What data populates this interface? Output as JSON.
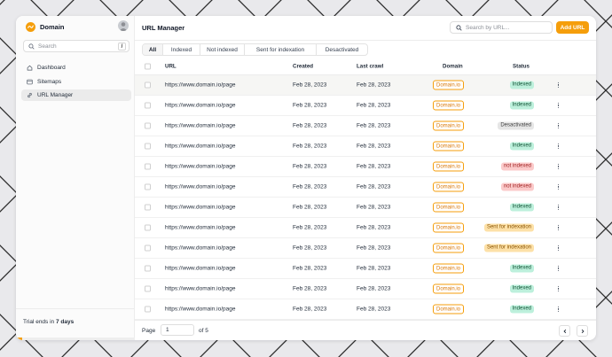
{
  "brand": {
    "name": "Domain",
    "color": "#f59e0b"
  },
  "sidebar": {
    "search_placeholder": "Search",
    "search_shortcut": "/",
    "items": [
      {
        "label": "Dashboard",
        "icon": "home-icon"
      },
      {
        "label": "Sitemaps",
        "icon": "sitemap-icon"
      },
      {
        "label": "URL Manager",
        "icon": "link-icon",
        "active": true
      }
    ],
    "trial": {
      "prefix": "Trial ends in ",
      "days": "7 days",
      "progress": 0.05
    }
  },
  "header": {
    "title": "URL Manager",
    "search_placeholder": "Search by URL...",
    "add_label": "Add URL"
  },
  "tabs": [
    "All",
    "Indexed",
    "Not indexed",
    "Sent for indexation",
    "Desactivated"
  ],
  "table": {
    "columns": {
      "url": "URL",
      "created": "Created",
      "crawl": "Last crawl",
      "domain": "Domain",
      "status": "Status"
    },
    "rows": [
      {
        "url": "https://www.domain.io/page",
        "created": "Feb 28, 2023",
        "crawl": "Feb 28, 2023",
        "domain": "Domain.io",
        "status": "Indexed",
        "kind": "indexed"
      },
      {
        "url": "https://www.domain.io/page",
        "created": "Feb 28, 2023",
        "crawl": "Feb 28, 2023",
        "domain": "Domain.io",
        "status": "Indexed",
        "kind": "indexed"
      },
      {
        "url": "https://www.domain.io/page",
        "created": "Feb 28, 2023",
        "crawl": "Feb 28, 2023",
        "domain": "Domain.io",
        "status": "Desactivated",
        "kind": "deactivated"
      },
      {
        "url": "https://www.domain.io/page",
        "created": "Feb 28, 2023",
        "crawl": "Feb 28, 2023",
        "domain": "Domain.io",
        "status": "Indexed",
        "kind": "indexed"
      },
      {
        "url": "https://www.domain.io/page",
        "created": "Feb 28, 2023",
        "crawl": "Feb 28, 2023",
        "domain": "Domain.io",
        "status": "not indexed",
        "kind": "not"
      },
      {
        "url": "https://www.domain.io/page",
        "created": "Feb 28, 2023",
        "crawl": "Feb 28, 2023",
        "domain": "Domain.io",
        "status": "not indexed",
        "kind": "not"
      },
      {
        "url": "https://www.domain.io/page",
        "created": "Feb 28, 2023",
        "crawl": "Feb 28, 2023",
        "domain": "Domain.io",
        "status": "Indexed",
        "kind": "indexed"
      },
      {
        "url": "https://www.domain.io/page",
        "created": "Feb 28, 2023",
        "crawl": "Feb 28, 2023",
        "domain": "Domain.io",
        "status": "Sent for indexation",
        "kind": "sent"
      },
      {
        "url": "https://www.domain.io/page",
        "created": "Feb 28, 2023",
        "crawl": "Feb 28, 2023",
        "domain": "Domain.io",
        "status": "Sent for indexation",
        "kind": "sent"
      },
      {
        "url": "https://www.domain.io/page",
        "created": "Feb 28, 2023",
        "crawl": "Feb 28, 2023",
        "domain": "Domain.io",
        "status": "Indexed",
        "kind": "indexed"
      },
      {
        "url": "https://www.domain.io/page",
        "created": "Feb 28, 2023",
        "crawl": "Feb 28, 2023",
        "domain": "Domain.io",
        "status": "Indexed",
        "kind": "indexed"
      },
      {
        "url": "https://www.domain.io/page",
        "created": "Feb 28, 2023",
        "crawl": "Feb 28, 2023",
        "domain": "Domain.io",
        "status": "Indexed",
        "kind": "indexed"
      }
    ]
  },
  "pagination": {
    "label": "Page",
    "current": "1",
    "of": "of 5"
  }
}
